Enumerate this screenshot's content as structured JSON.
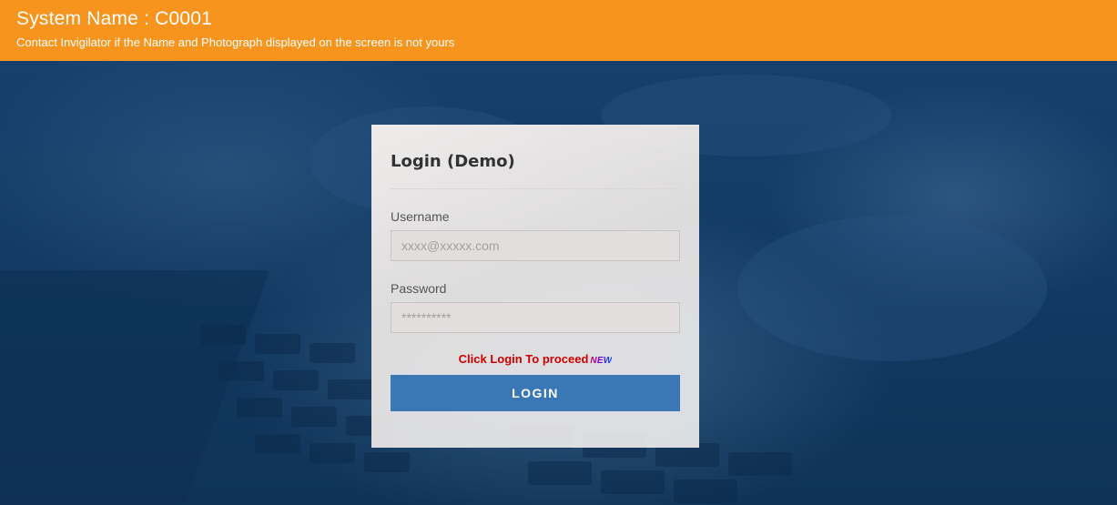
{
  "header": {
    "system_name": "System Name : C0001",
    "notice": "Contact Invigilator if the Name and Photograph displayed on the screen is not yours"
  },
  "login": {
    "title": "Login (Demo)",
    "username_label": "Username",
    "username_placeholder": "xxxx@xxxxx.com",
    "password_label": "Password",
    "password_placeholder": "**********",
    "proceed_text": "Click Login To proceed",
    "new_badge": "NEW",
    "button_label": "LOGIN"
  },
  "colors": {
    "header_bg": "#f7941e",
    "background": "#123a63",
    "button_bg": "#3a78b5",
    "proceed_text": "#cc0000"
  }
}
